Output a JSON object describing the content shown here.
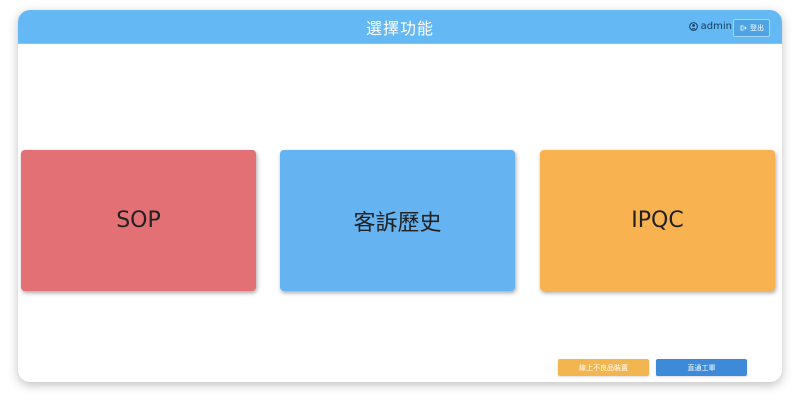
{
  "header": {
    "title": "選擇功能",
    "user_name": "admin",
    "logout_label": "登出"
  },
  "cards": {
    "sop": "SOP",
    "history": "客訴歷史",
    "ipqc": "IPQC"
  },
  "footer": {
    "left_button": "線上不良品裝置",
    "right_button": "直通工單"
  },
  "colors": {
    "header": "#64b8f4",
    "sop": "#e27074",
    "history": "#65b3f0",
    "ipqc": "#f8b24f",
    "yellow_button": "#f3b54f",
    "blue_button": "#3c8ad8"
  }
}
